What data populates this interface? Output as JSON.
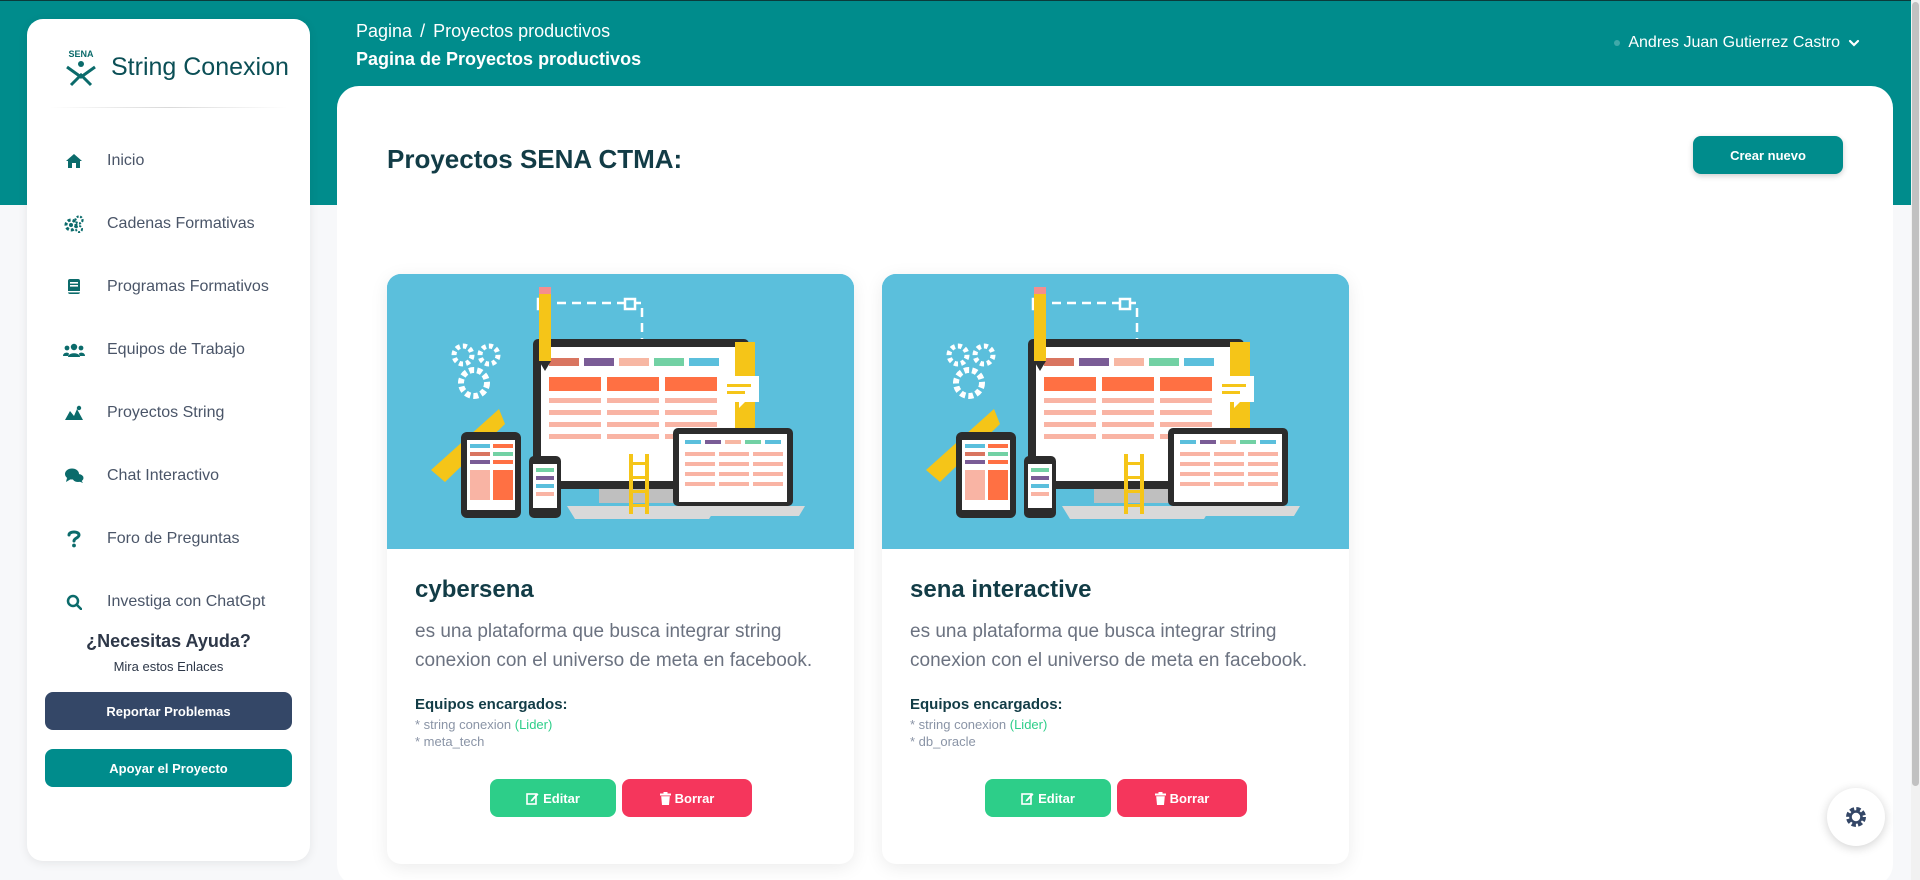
{
  "topbar": {
    "breadcrumb": {
      "root": "Pagina",
      "separator": "/",
      "current": "Proyectos productivos"
    },
    "page_title": "Pagina de Proyectos productivos",
    "user_name": "Andres Juan Gutierrez Castro"
  },
  "sidebar": {
    "brand": "String Conexion",
    "items": [
      {
        "label": "Inicio",
        "icon": "home-icon"
      },
      {
        "label": "Cadenas Formativas",
        "icon": "gears-icon"
      },
      {
        "label": "Programas Formativos",
        "icon": "book-icon"
      },
      {
        "label": "Equipos de Trabajo",
        "icon": "users-icon"
      },
      {
        "label": "Proyectos String",
        "icon": "project-icon"
      },
      {
        "label": "Chat Interactivo",
        "icon": "comments-icon"
      },
      {
        "label": "Foro de Preguntas",
        "icon": "question-icon"
      },
      {
        "label": "Investiga con ChatGpt",
        "icon": "search-icon"
      }
    ],
    "help_title": "¿Necesitas Ayuda?",
    "help_subtitle": "Mira estos Enlaces",
    "report_button": "Reportar Problemas",
    "support_button": "Apoyar el Proyecto"
  },
  "main": {
    "title": "Proyectos SENA CTMA:",
    "create_button": "Crear nuevo",
    "cards": [
      {
        "title": "cybersena",
        "description": "es una plataforma que busca integrar string conexion con el universo de meta en facebook.",
        "teams_label": "Equipos encargados:",
        "teams": [
          {
            "text": "* string conexion",
            "badge": "(Lider)"
          },
          {
            "text": "* meta_tech",
            "badge": ""
          }
        ],
        "edit_label": "Editar",
        "delete_label": "Borrar"
      },
      {
        "title": "sena interactive",
        "description": "es una plataforma que busca integrar string conexion con el universo de meta en facebook.",
        "teams_label": "Equipos encargados:",
        "teams": [
          {
            "text": "* string conexion",
            "badge": "(Lider)"
          },
          {
            "text": "* db_oracle",
            "badge": ""
          }
        ],
        "edit_label": "Editar",
        "delete_label": "Borrar"
      }
    ]
  },
  "colors": {
    "brand_teal": "#008c8c",
    "edit_green": "#2dce89",
    "delete_red": "#f5365c",
    "report_navy": "#344767"
  }
}
